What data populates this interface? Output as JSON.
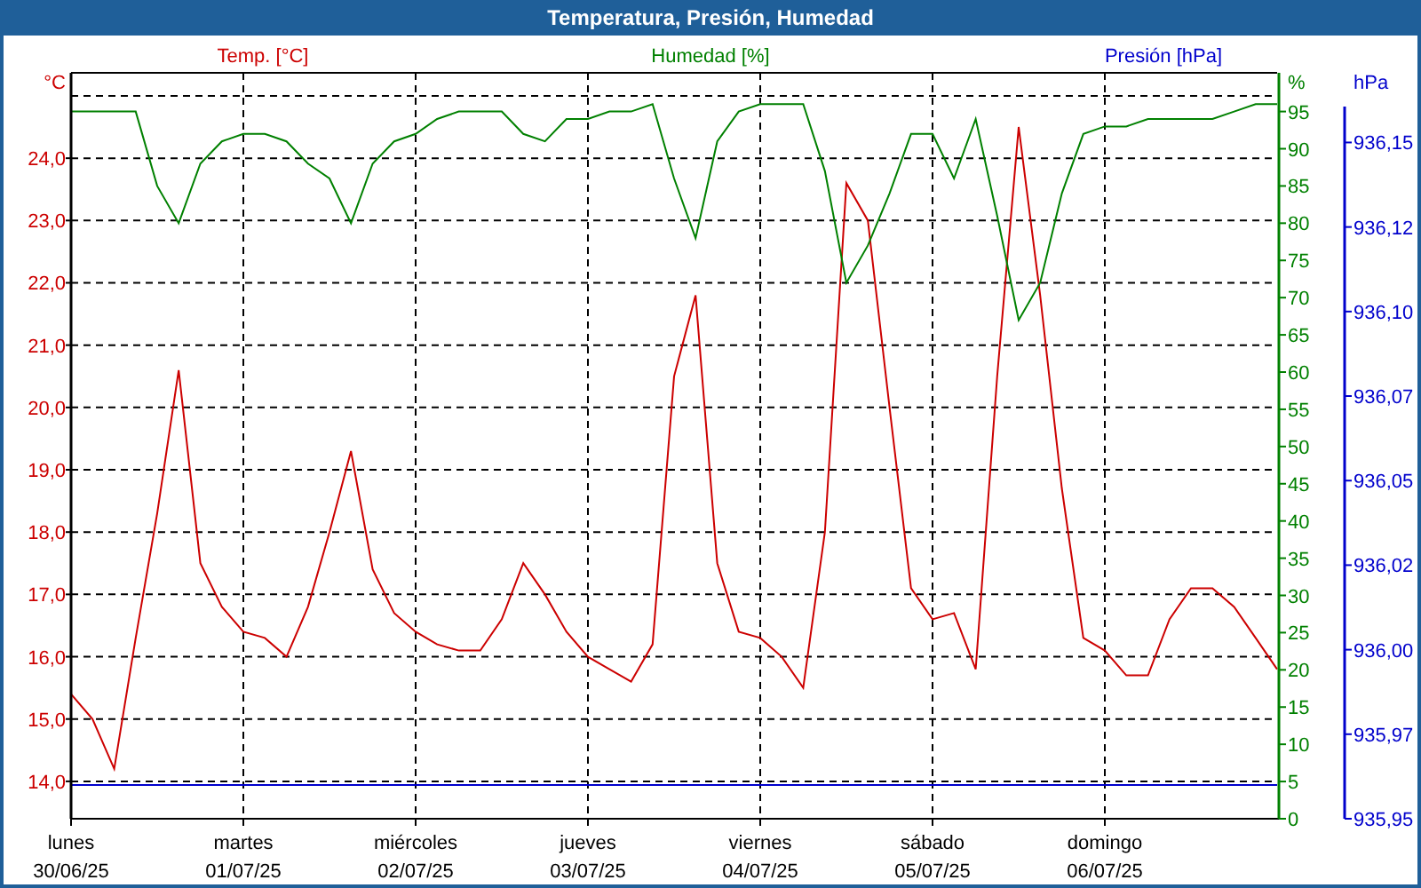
{
  "window": {
    "title": "Temperatura, Presión, Humedad"
  },
  "chart": {
    "chart_data": {
      "type": "line",
      "categories": [
        "lunes 30/06/25",
        null,
        null,
        null,
        null,
        null,
        null,
        null,
        "martes 01/07/25",
        null,
        null,
        null,
        null,
        null,
        null,
        null,
        "miércoles 02/07/25",
        null,
        null,
        null,
        null,
        null,
        null,
        null,
        "jueves 03/07/25",
        null,
        null,
        null,
        null,
        null,
        null,
        null,
        "viernes 04/07/25",
        null,
        null,
        null,
        null,
        null,
        null,
        null,
        "sábado 05/07/25",
        null,
        null,
        null,
        null,
        null,
        null,
        null,
        "domingo 06/07/25",
        null,
        null,
        null,
        null,
        null,
        null,
        null,
        null
      ],
      "grid": true,
      "ylabel": "°C",
      "ylim": [
        13.4,
        25.37
      ],
      "yticks": [
        {
          "value": 14,
          "label": "14,0"
        },
        {
          "value": 15,
          "label": "15,0"
        },
        {
          "value": 16,
          "label": "16,0"
        },
        {
          "value": 17,
          "label": "17,0"
        },
        {
          "value": 18,
          "label": "18,0"
        },
        {
          "value": 19,
          "label": "19,0"
        },
        {
          "value": 20,
          "label": "20,0"
        },
        {
          "value": 21,
          "label": "21,0"
        },
        {
          "value": 22,
          "label": "22,0"
        },
        {
          "value": 23,
          "label": "23,0"
        },
        {
          "value": 24,
          "label": "24,0"
        }
      ],
      "y2label": "%",
      "y2lim": [
        0,
        100.2
      ],
      "y2ticks": [
        0,
        5,
        10,
        15,
        20,
        25,
        30,
        35,
        40,
        45,
        50,
        55,
        60,
        65,
        70,
        75,
        80,
        85,
        90,
        95
      ],
      "y3label": "hPa",
      "y3lim": [
        935.95,
        936.1706
      ],
      "y3ticks": [
        {
          "value": 935.95,
          "label": "935,95"
        },
        {
          "value": 935.975,
          "label": "935,97"
        },
        {
          "value": 936.0,
          "label": "936,00"
        },
        {
          "value": 936.025,
          "label": "936,02"
        },
        {
          "value": 936.05,
          "label": "936,05"
        },
        {
          "value": 936.075,
          "label": "936,07"
        },
        {
          "value": 936.1,
          "label": "936,10"
        },
        {
          "value": 936.125,
          "label": "936,12"
        },
        {
          "value": 936.15,
          "label": "936,15"
        }
      ],
      "series": [
        {
          "name": "Temp. [°C]",
          "color": "#cc0000",
          "values": [
            15.4,
            15.0,
            14.2,
            16.3,
            18.3,
            20.6,
            17.5,
            16.8,
            16.4,
            16.3,
            16.0,
            16.8,
            18.0,
            19.3,
            17.4,
            16.7,
            16.4,
            16.2,
            16.1,
            16.1,
            16.6,
            17.5,
            17.0,
            16.4,
            16.0,
            15.8,
            15.6,
            16.2,
            20.5,
            21.8,
            17.5,
            16.4,
            16.3,
            16.0,
            15.5,
            18.0,
            23.6,
            23.0,
            20.0,
            17.1,
            16.6,
            16.7,
            15.8,
            20.5,
            24.5,
            21.8,
            18.7,
            16.3,
            16.1,
            15.7,
            15.7,
            16.6,
            17.1,
            17.1,
            16.8,
            16.3,
            15.8
          ]
        },
        {
          "name": "Humedad [%]",
          "color": "#008000",
          "axis": "y2",
          "values": [
            95,
            95,
            95,
            95,
            85,
            80,
            88,
            91,
            92,
            92,
            91,
            88,
            86,
            80,
            88,
            91,
            92,
            94,
            95,
            95,
            95,
            92,
            91,
            94,
            94,
            95,
            95,
            96,
            86,
            78,
            91,
            95,
            96,
            96,
            96,
            87,
            72,
            77,
            84,
            92,
            92,
            86,
            94,
            81,
            67,
            72,
            84,
            92,
            93,
            93,
            94,
            94,
            94,
            94,
            95,
            96,
            96
          ]
        },
        {
          "name": "Presión [hPa]",
          "color": "#0000cc",
          "axis": "y3",
          "values": [
            935.96,
            935.96,
            935.96,
            935.96,
            935.96,
            935.96,
            935.96,
            935.96,
            935.96,
            935.96,
            935.96,
            935.96,
            935.96,
            935.96,
            935.96,
            935.96,
            935.96,
            935.96,
            935.96,
            935.96,
            935.96,
            935.96,
            935.96,
            935.96,
            935.96,
            935.96,
            935.96,
            935.96,
            935.96,
            935.96,
            935.96,
            935.96,
            935.96,
            935.96,
            935.96,
            935.96,
            935.96,
            935.96,
            935.96,
            935.96,
            935.96,
            935.96,
            935.96,
            935.96,
            935.96,
            935.96,
            935.96,
            935.96,
            935.96,
            935.96,
            935.96,
            935.96,
            935.96,
            935.96,
            935.96,
            935.96,
            935.96
          ]
        }
      ]
    }
  }
}
